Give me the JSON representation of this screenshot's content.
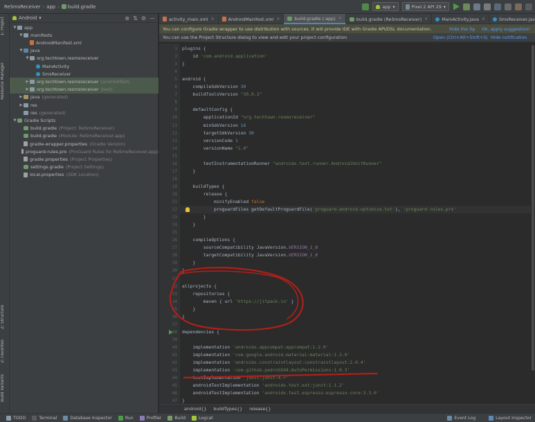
{
  "navbar": {
    "crumbs": [
      "ReSmsReceiver",
      "app",
      "build.gradle"
    ],
    "config_combo": "app",
    "device_combo": "Pixel 2 API 29"
  },
  "project_panel": {
    "view_mode": "Android",
    "tree": [
      {
        "label": "app",
        "note": "",
        "icon": "folder-icon",
        "depth": 0,
        "arrow": "down"
      },
      {
        "label": "manifests",
        "note": "",
        "icon": "folder-icon",
        "depth": 1,
        "arrow": "down"
      },
      {
        "label": "AndroidManifest.xml",
        "note": "",
        "icon": "xml-file-icon",
        "depth": 2,
        "arrow": ""
      },
      {
        "label": "java",
        "note": "",
        "icon": "source-folder-icon",
        "depth": 1,
        "arrow": "down"
      },
      {
        "label": "org.techtown.resmsreceiver",
        "note": "",
        "icon": "package-icon",
        "depth": 2,
        "arrow": "down"
      },
      {
        "label": "MainActivity",
        "note": "",
        "icon": "class-icon",
        "depth": 3,
        "arrow": ""
      },
      {
        "label": "SmsReceiver",
        "note": "",
        "icon": "class-icon",
        "depth": 3,
        "arrow": ""
      },
      {
        "label": "org.techtown.resmsreceiver",
        "note": "(androidTest)",
        "icon": "package-icon",
        "depth": 2,
        "arrow": "right",
        "selected": true
      },
      {
        "label": "org.techtown.resmsreceiver",
        "note": "(test)",
        "icon": "package-icon",
        "depth": 2,
        "arrow": "right",
        "selected": true
      },
      {
        "label": "java",
        "note": "(generated)",
        "icon": "generated-folder-icon",
        "depth": 1,
        "arrow": "right"
      },
      {
        "label": "res",
        "note": "",
        "icon": "folder-icon",
        "depth": 1,
        "arrow": "right"
      },
      {
        "label": "res",
        "note": "(generated)",
        "icon": "folder-icon",
        "depth": 1,
        "arrow": ""
      },
      {
        "label": "Gradle Scripts",
        "note": "",
        "icon": "gradle-icon",
        "depth": 0,
        "arrow": "down"
      },
      {
        "label": "build.gradle",
        "note": "(Project: ReSmsReceiver)",
        "icon": "gradle-icon",
        "depth": 1,
        "arrow": ""
      },
      {
        "label": "build.gradle",
        "note": "(Module: ReSmsReceiver.app)",
        "icon": "gradle-icon",
        "depth": 1,
        "arrow": ""
      },
      {
        "label": "gradle-wrapper.properties",
        "note": "(Gradle Version)",
        "icon": "file-icon",
        "depth": 1,
        "arrow": ""
      },
      {
        "label": "proguard-rules.pro",
        "note": "(ProGuard Rules for ReSmsReceiver.app)",
        "icon": "file-icon",
        "depth": 1,
        "arrow": ""
      },
      {
        "label": "gradle.properties",
        "note": "(Project Properties)",
        "icon": "file-icon",
        "depth": 1,
        "arrow": ""
      },
      {
        "label": "settings.gradle",
        "note": "(Project Settings)",
        "icon": "gradle-icon",
        "depth": 1,
        "arrow": ""
      },
      {
        "label": "local.properties",
        "note": "(SDK Location)",
        "icon": "file-icon",
        "depth": 1,
        "arrow": ""
      }
    ]
  },
  "left_stripe": {
    "project": "1: Project",
    "resource_manager": "Resource Manager",
    "structure": "Z: Structure",
    "favorites": "2: Favorites",
    "build_variants": "Build Variants"
  },
  "tabs": [
    {
      "label": "activity_main.xml",
      "icon": "xml-file-icon",
      "active": false
    },
    {
      "label": "AndroidManifest.xml",
      "icon": "xml-file-icon",
      "active": false
    },
    {
      "label": "build.gradle (:app)",
      "icon": "gradle-icon",
      "active": true
    },
    {
      "label": "build.gradle (ReSmsReceiver)",
      "icon": "gradle-icon",
      "active": false
    },
    {
      "label": "MainActivity.java",
      "icon": "class-icon",
      "active": false
    },
    {
      "label": "SmsReceiver.java",
      "icon": "class-icon",
      "active": false
    }
  ],
  "banners": {
    "wrapper_msg": "You can configure Gradle wrapper to use distribution with sources. It will provide IDE with Gradle API/DSL documentation.",
    "hide_tip": "Hide the tip",
    "ok_apply": "Ok, apply suggestion!",
    "structure_msg": "You can use the Project Structure dialog to view and edit your project configuration",
    "open_link": "Open (Ctrl+Alt+Shift+S)",
    "hide_notification": "Hide notification"
  },
  "code": {
    "first_line_number": 1,
    "current_line": 22,
    "lines": [
      [
        [
          "plugins {",
          "p"
        ]
      ],
      [
        [
          "    id ",
          "p"
        ],
        [
          "'com.android.application'",
          "s"
        ]
      ],
      [
        [
          "}",
          "p"
        ]
      ],
      [
        [
          "",
          "p"
        ]
      ],
      [
        [
          "android {",
          "p"
        ]
      ],
      [
        [
          "    compileSdkVersion ",
          "p"
        ],
        [
          "30",
          "n"
        ]
      ],
      [
        [
          "    buildToolsVersion ",
          "p"
        ],
        [
          "\"30.0.3\"",
          "s"
        ]
      ],
      [
        [
          "",
          "p"
        ]
      ],
      [
        [
          "    defaultConfig {",
          "p"
        ]
      ],
      [
        [
          "        applicationId ",
          "p"
        ],
        [
          "\"org.techtown.resmsreceiver\"",
          "s"
        ]
      ],
      [
        [
          "        minSdkVersion ",
          "p"
        ],
        [
          "16",
          "n"
        ]
      ],
      [
        [
          "        targetSdkVersion ",
          "p"
        ],
        [
          "30",
          "n"
        ]
      ],
      [
        [
          "        versionCode ",
          "p"
        ],
        [
          "1",
          "n"
        ]
      ],
      [
        [
          "        versionName ",
          "p"
        ],
        [
          "\"1.0\"",
          "s"
        ]
      ],
      [
        [
          "",
          "p"
        ]
      ],
      [
        [
          "        testInstrumentationRunner ",
          "p"
        ],
        [
          "\"androidx.test.runner.AndroidJUnitRunner\"",
          "s"
        ]
      ],
      [
        [
          "    }",
          "p"
        ]
      ],
      [
        [
          "",
          "p"
        ]
      ],
      [
        [
          "    buildTypes {",
          "p"
        ]
      ],
      [
        [
          "        release {",
          "p"
        ]
      ],
      [
        [
          "            minifyEnabled ",
          "p"
        ],
        [
          "false",
          "k"
        ]
      ],
      [
        [
          "            proguardFiles getDefaultProguardFile(",
          "p"
        ],
        [
          "'proguard-android-optimize.txt'",
          "s"
        ],
        [
          "), ",
          "p"
        ],
        [
          "'proguard-rules.pro'",
          "s"
        ]
      ],
      [
        [
          "        }",
          "p"
        ]
      ],
      [
        [
          "    }",
          "p"
        ]
      ],
      [
        [
          "",
          "p"
        ]
      ],
      [
        [
          "    compileOptions {",
          "p"
        ]
      ],
      [
        [
          "        sourceCompatibility JavaVersion.",
          "p"
        ],
        [
          "VERSION_1_8",
          "i"
        ]
      ],
      [
        [
          "        targetCompatibility JavaVersion.",
          "p"
        ],
        [
          "VERSION_1_8",
          "i"
        ]
      ],
      [
        [
          "    }",
          "p"
        ]
      ],
      [
        [
          "}",
          "p"
        ]
      ],
      [
        [
          "",
          "p"
        ]
      ],
      [
        [
          "allprojects {",
          "p"
        ]
      ],
      [
        [
          "    repositories {",
          "p"
        ]
      ],
      [
        [
          "        maven { url ",
          "p"
        ],
        [
          "'https://jitpack.io'",
          "s"
        ],
        [
          " }",
          "p"
        ]
      ],
      [
        [
          "    }",
          "p"
        ]
      ],
      [
        [
          "}",
          "p"
        ]
      ],
      [
        [
          "",
          "p"
        ]
      ],
      [
        [
          "dependencies {",
          "p"
        ]
      ],
      [
        [
          "",
          "p"
        ]
      ],
      [
        [
          "    implementation ",
          "p"
        ],
        [
          "'androidx.appcompat:appcompat:1.2.0'",
          "s"
        ]
      ],
      [
        [
          "    implementation ",
          "p"
        ],
        [
          "'com.google.android.material:material:1.3.0'",
          "s"
        ]
      ],
      [
        [
          "    implementation ",
          "p"
        ],
        [
          "'androidx.constraintlayout:constraintlayout:2.0.4'",
          "s"
        ]
      ],
      [
        [
          "    implementation ",
          "p"
        ],
        [
          "'com.github.pedroSG94:AutoPermissions:1.0.3'",
          "s"
        ]
      ],
      [
        [
          "    testImplementation ",
          "p"
        ],
        [
          "'junit:junit:4.+'",
          "s"
        ]
      ],
      [
        [
          "    androidTestImplementation ",
          "p"
        ],
        [
          "'androidx.test.ext:junit:1.1.2'",
          "s"
        ]
      ],
      [
        [
          "    androidTestImplementation ",
          "p"
        ],
        [
          "'androidx.test.espresso:espresso-core:3.3.0'",
          "s"
        ]
      ],
      [
        [
          "}",
          "p"
        ]
      ]
    ]
  },
  "breadcrumbs": [
    "android{}",
    "buildTypes{}",
    "release{}"
  ],
  "bottom_bar": {
    "left": [
      {
        "label": "TODO",
        "icon": "todo-icon"
      },
      {
        "label": "Terminal",
        "icon": "terminal-icon"
      },
      {
        "label": "Database Inspector",
        "icon": "database-icon"
      },
      {
        "label": "Run",
        "icon": "run-icon"
      },
      {
        "label": "Profiler",
        "icon": "profiler-icon"
      },
      {
        "label": "Build",
        "icon": "build-icon"
      },
      {
        "label": "Logcat",
        "icon": "logcat-icon"
      }
    ],
    "right": [
      {
        "label": "Event Log",
        "icon": "event-log-icon"
      },
      {
        "label": "Layout Inspector",
        "icon": "layout-inspector-icon"
      }
    ]
  },
  "colors": {
    "annotation_red": "#b0201a",
    "accent_blue": "#4a88c7"
  }
}
